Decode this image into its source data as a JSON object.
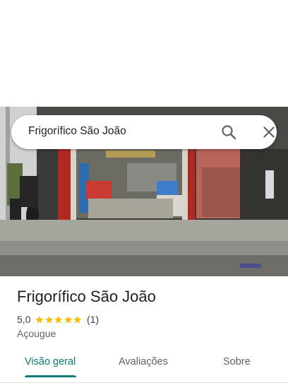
{
  "search": {
    "query": "Frigorífico São João",
    "search_icon": "search-icon",
    "close_icon": "close-icon"
  },
  "hero": {
    "image": "storefront-photo"
  },
  "place": {
    "title": "Frigorífico São João",
    "rating": "5,0",
    "stars": 5,
    "review_count": "(1)",
    "category": "Açougue"
  },
  "tabs": [
    {
      "label": "Visão geral",
      "selected": true
    },
    {
      "label": "Avaliações",
      "selected": false
    },
    {
      "label": "Sobre",
      "selected": false
    }
  ],
  "colors": {
    "accent": "#0b7a78",
    "star": "#fbbc04",
    "text": "#202124",
    "secondary_text": "#5f6368"
  }
}
